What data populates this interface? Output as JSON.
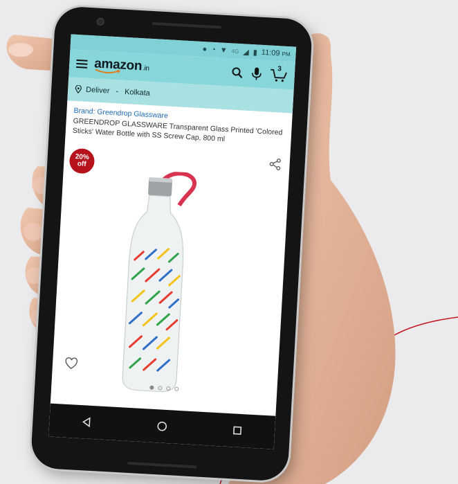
{
  "colors": {
    "accent_teal": "#86d6da",
    "discount_red": "#b5121b",
    "brand_blue": "#1f6cb6"
  },
  "statusbar": {
    "icons": [
      "location-icon",
      "alarm-icon",
      "wifi-icon",
      "signal-icon",
      "battery-icon"
    ],
    "network": "4G",
    "time": "11:09",
    "ampm": "PM"
  },
  "appbar": {
    "logo": "amazon",
    "logo_suffix": ".in",
    "cart_count": "3",
    "icons": [
      "menu-icon",
      "search-icon",
      "mic-icon",
      "cart-icon"
    ]
  },
  "deliver": {
    "label": "Deliver",
    "sep": " - ",
    "city": "Kolkata"
  },
  "product": {
    "brand": "Brand: Greendrop Glassware",
    "title": "GREENDROP GLASSWARE Transparent Glass Printed 'Colored Sticks' Water Bottle with SS Screw Cap, 800 ml",
    "discount_pct": "20%",
    "discount_word": "off",
    "image_count": 4,
    "active_image": 1
  },
  "navbar": {
    "icons": [
      "back-icon",
      "home-icon",
      "recents-icon"
    ]
  }
}
